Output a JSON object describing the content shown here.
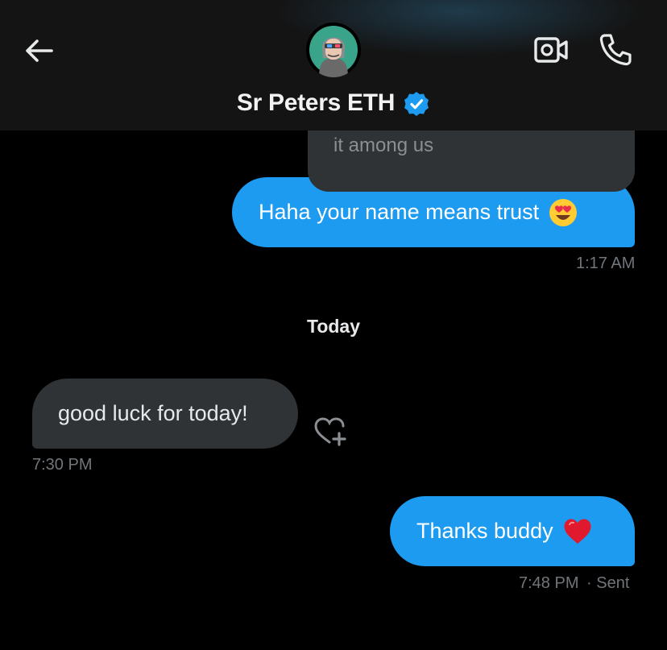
{
  "header": {
    "contact_name": "Sr Peters ETH",
    "icons": [
      "back-arrow-icon",
      "avatar",
      "verified-badge-icon",
      "video-call-icon",
      "phone-call-icon"
    ],
    "accent_color": "#1d9bf0"
  },
  "messages": [
    {
      "direction": "incoming",
      "text": "it among us",
      "partial": true
    },
    {
      "direction": "outgoing",
      "text": "Haha your name means trust",
      "emoji": "heart-eyes-emoji",
      "time": "1:17 AM"
    },
    {
      "divider": "Today"
    },
    {
      "direction": "incoming",
      "text": "good luck for today!",
      "time": "7:30 PM",
      "action": "add-reaction-icon"
    },
    {
      "direction": "outgoing",
      "text": "Thanks buddy",
      "emoji": "red-heart-emoji",
      "time": "7:48 PM",
      "status": "· Sent"
    }
  ],
  "colors": {
    "background": "#000000",
    "outgoing_bubble": "#1d9bf0",
    "incoming_bubble": "#2f3336",
    "timestamp": "#71767b"
  }
}
